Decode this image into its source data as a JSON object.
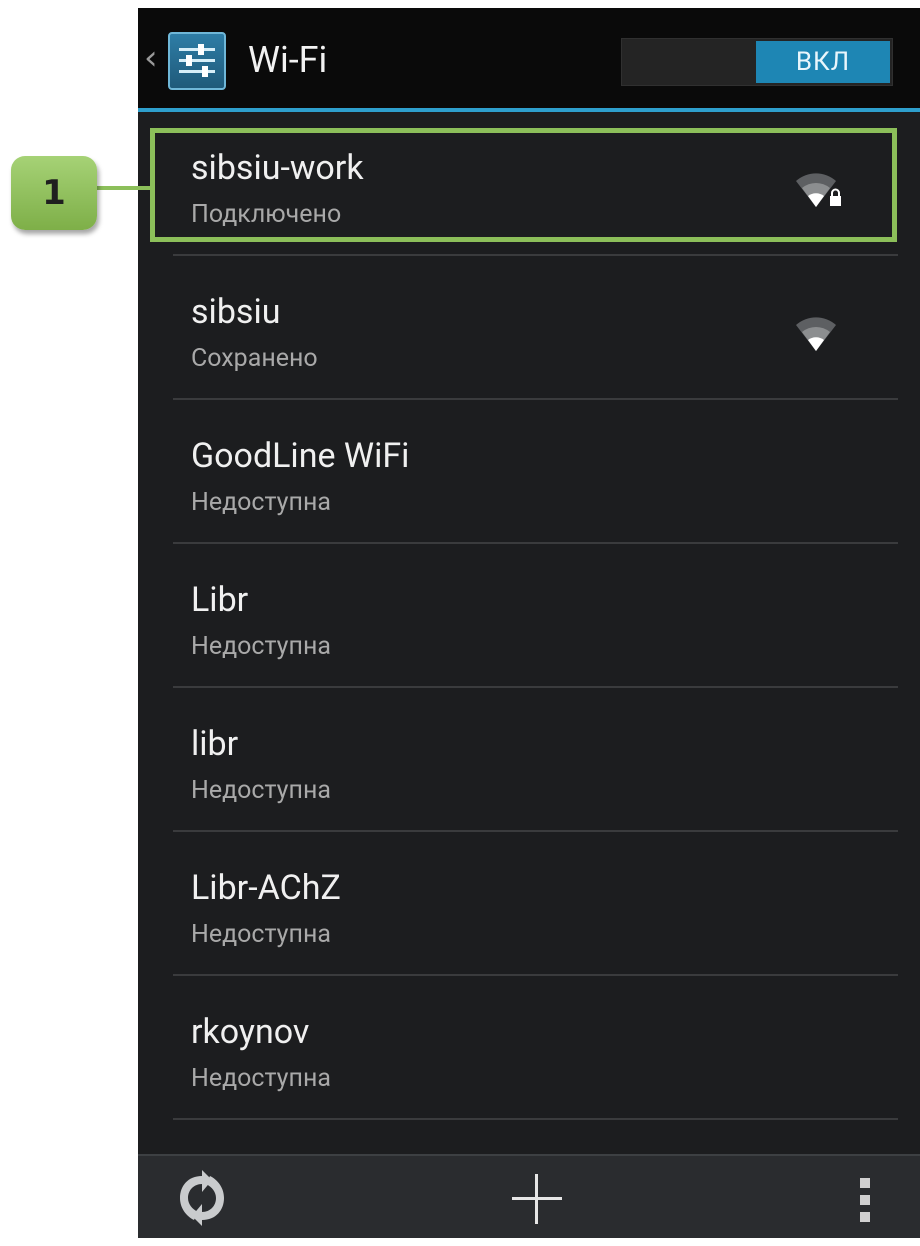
{
  "header": {
    "title": "Wi-Fi",
    "toggle_label": "ВКЛ"
  },
  "callout": {
    "number": "1"
  },
  "networks": [
    {
      "ssid": "sibsiu-work",
      "status": "Подключено",
      "signal_icon": "wifi-locked-icon"
    },
    {
      "ssid": "sibsiu",
      "status": "Сохранено",
      "signal_icon": "wifi-icon"
    },
    {
      "ssid": "GoodLine WiFi",
      "status": "Недоступна"
    },
    {
      "ssid": "Libr",
      "status": "Недоступна"
    },
    {
      "ssid": "libr",
      "status": "Недоступна"
    },
    {
      "ssid": "Libr-AChZ",
      "status": "Недоступна"
    },
    {
      "ssid": "rkoynov",
      "status": "Недоступна"
    }
  ],
  "colors": {
    "accent": "#2e9fcd",
    "toggle_on": "#1e86b4",
    "highlight": "#8cbf5a"
  },
  "bottombar": {
    "icons": [
      "wps-icon",
      "add-icon",
      "overflow-menu-icon"
    ]
  }
}
